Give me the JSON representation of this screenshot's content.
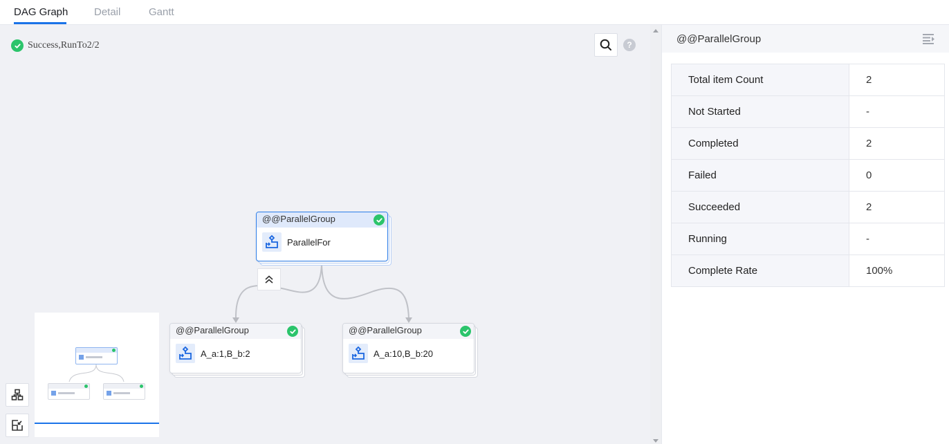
{
  "tabs": [
    {
      "label": "DAG Graph",
      "active": true
    },
    {
      "label": "Detail",
      "active": false
    },
    {
      "label": "Gantt",
      "active": false
    }
  ],
  "canvas": {
    "status_text": "Success,RunTo2/2",
    "status_icon": "check-circle-icon",
    "search_icon": "search-icon",
    "help_icon_label": "?",
    "collapse_icon": "double-chevron-up-icon",
    "tool_buttons": [
      {
        "name": "auto-layout",
        "icon": "hierarchy-icon"
      },
      {
        "name": "fit-view",
        "icon": "fit-to-screen-icon"
      }
    ]
  },
  "nodes": [
    {
      "id": "root",
      "group": "@@ParallelGroup",
      "label": "ParallelFor",
      "status": "success",
      "selected": true
    },
    {
      "id": "child1",
      "group": "@@ParallelGroup",
      "label": "A_a:1,B_b:2",
      "status": "success",
      "selected": false
    },
    {
      "id": "child2",
      "group": "@@ParallelGroup",
      "label": "A_a:10,B_b:20",
      "status": "success",
      "selected": false
    }
  ],
  "edges": [
    {
      "from": "root",
      "to": "child1"
    },
    {
      "from": "root",
      "to": "child2"
    }
  ],
  "panel": {
    "title": "@@ParallelGroup",
    "menu_icon": "collapse-panel-icon",
    "rows": [
      {
        "key": "Total item Count",
        "value": "2"
      },
      {
        "key": "Not Started",
        "value": "-"
      },
      {
        "key": "Completed",
        "value": "2"
      },
      {
        "key": "Failed",
        "value": "0"
      },
      {
        "key": "Succeeded",
        "value": "2"
      },
      {
        "key": "Running",
        "value": "-"
      },
      {
        "key": "Complete Rate",
        "value": "100%"
      }
    ]
  },
  "colors": {
    "accent": "#1a73e8",
    "success": "#2bc46b",
    "selected_border": "#2b7de9",
    "canvas_bg": "#f0f1f5"
  }
}
